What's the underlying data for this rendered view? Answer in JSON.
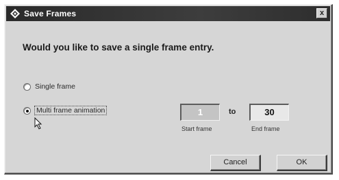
{
  "window": {
    "title": "Save Frames",
    "close_glyph": "x",
    "icon": "diamond-app-icon"
  },
  "prompt": {
    "question": "Would you like to save a single frame entry."
  },
  "options": {
    "single": {
      "label": "Single frame",
      "selected": false
    },
    "multi": {
      "label": "Multi frame animation",
      "selected": true
    }
  },
  "range": {
    "start_value": "1",
    "to_label": "to",
    "end_value": "30",
    "start_caption": "Start frame",
    "end_caption": "End frame"
  },
  "buttons": {
    "cancel": "Cancel",
    "ok": "OK"
  },
  "colors": {
    "titlebar": "#2a2a2a",
    "dialog_face": "#d6d6d6"
  }
}
